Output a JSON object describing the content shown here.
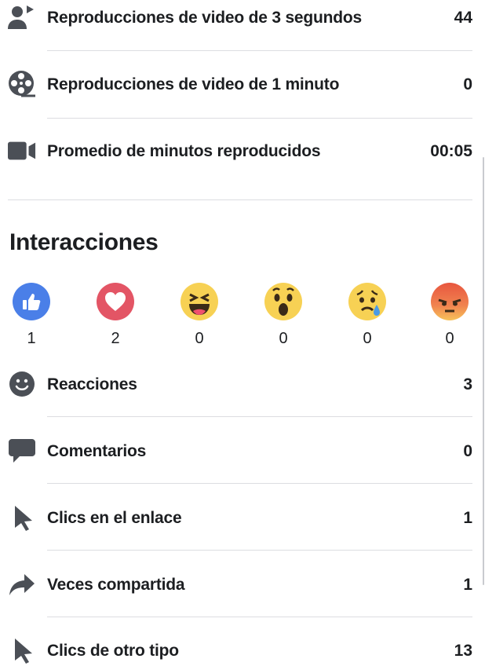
{
  "video_metrics": [
    {
      "icon": "user-video-icon",
      "label": "Reproducciones de video de 3 segundos",
      "value": "44"
    },
    {
      "icon": "film-reel-icon",
      "label": "Reproducciones de video de 1 minuto",
      "value": "0"
    },
    {
      "icon": "video-camera-icon",
      "label": "Promedio de minutos reproducidos",
      "value": "00:05"
    }
  ],
  "interactions": {
    "title": "Interacciones",
    "reactions": [
      {
        "icon": "like-reaction-icon",
        "count": "1"
      },
      {
        "icon": "love-reaction-icon",
        "count": "2"
      },
      {
        "icon": "haha-reaction-icon",
        "count": "0"
      },
      {
        "icon": "wow-reaction-icon",
        "count": "0"
      },
      {
        "icon": "sad-reaction-icon",
        "count": "0"
      },
      {
        "icon": "angry-reaction-icon",
        "count": "0"
      }
    ],
    "metrics": [
      {
        "icon": "smiley-icon",
        "label": "Reacciones",
        "value": "3"
      },
      {
        "icon": "comment-icon",
        "label": "Comentarios",
        "value": "0"
      },
      {
        "icon": "cursor-icon",
        "label": "Clics en el enlace",
        "value": "1"
      },
      {
        "icon": "share-arrow-icon",
        "label": "Veces compartida",
        "value": "1"
      },
      {
        "icon": "cursor-icon",
        "label": "Clics de otro tipo",
        "value": "13"
      }
    ]
  }
}
